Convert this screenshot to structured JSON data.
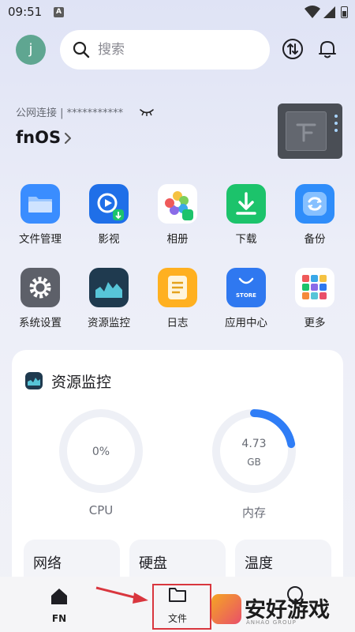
{
  "status_bar": {
    "time": "09:51",
    "notif_icon": "A"
  },
  "header": {
    "avatar_letter": "j",
    "search_placeholder": "搜索"
  },
  "device": {
    "connection_label": "公网连接 | ***********",
    "name": "fnOS"
  },
  "apps": [
    {
      "label": "文件管理",
      "icon": "folder-icon",
      "color": "#3a8dff"
    },
    {
      "label": "影视",
      "icon": "video-icon",
      "color": "#1f6fe8"
    },
    {
      "label": "相册",
      "icon": "photos-icon",
      "color": "#ffffff"
    },
    {
      "label": "下载",
      "icon": "download-icon",
      "color": "#1cc36b"
    },
    {
      "label": "备份",
      "icon": "backup-icon",
      "color": "#2f8dfa"
    },
    {
      "label": "系统设置",
      "icon": "gear-icon",
      "color": "#5d6069"
    },
    {
      "label": "资源监控",
      "icon": "monitor-icon",
      "color": "#1f3a4f"
    },
    {
      "label": "日志",
      "icon": "log-icon",
      "color": "#ffb020"
    },
    {
      "label": "应用中心",
      "icon": "store-icon",
      "color": "#2f78f0"
    },
    {
      "label": "更多",
      "icon": "more-icon",
      "color": "#ffffff"
    }
  ],
  "store_badge": "STORE",
  "monitor": {
    "title": "资源监控",
    "cpu": {
      "value": "0%",
      "label": "CPU",
      "fraction": 0
    },
    "memory": {
      "value": "4.73",
      "unit": "GB",
      "label": "内存",
      "fraction": 0.22
    },
    "tiles": [
      "网络",
      "硬盘",
      "温度"
    ]
  },
  "bottom_nav": {
    "fn_label": "FN",
    "files_label": "文件"
  },
  "watermark": {
    "text": "安好游戏",
    "sub": "ANHAO GROUP"
  }
}
